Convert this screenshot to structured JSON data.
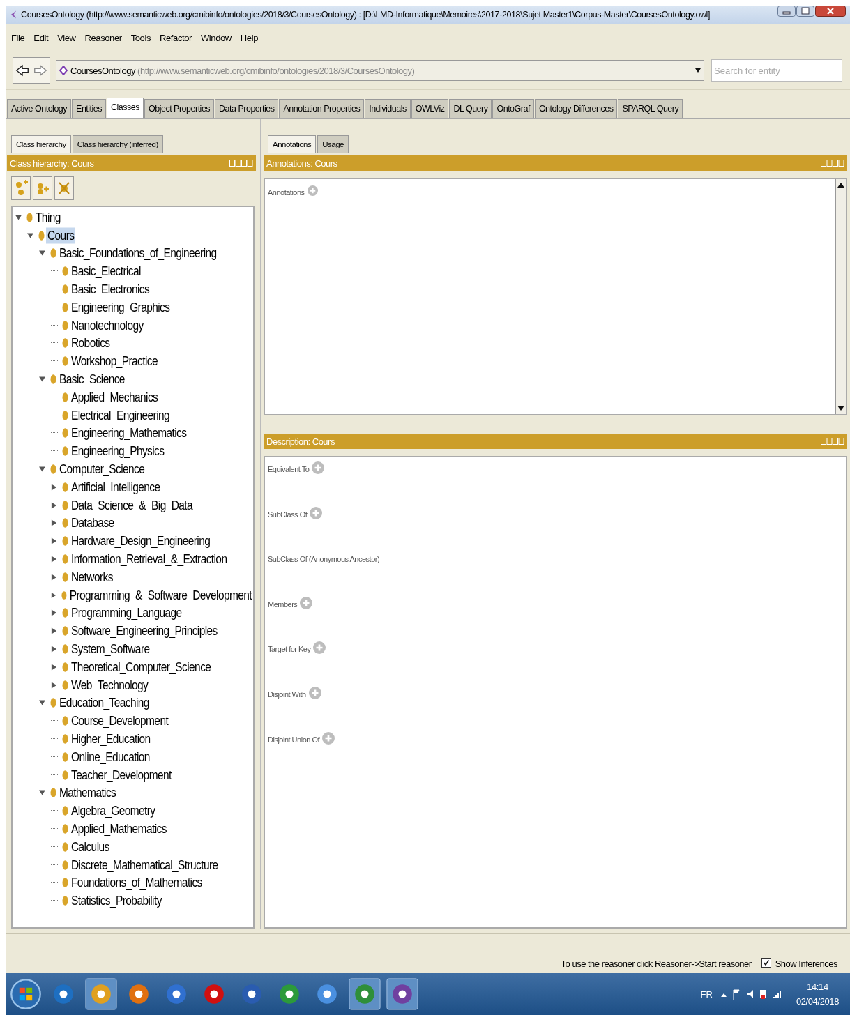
{
  "window": {
    "title": "CoursesOntology (http://www.semanticweb.org/cmibinfo/ontologies/2018/3/CoursesOntology)  : [D:\\LMD-Informatique\\Memoires\\2017-2018\\Sujet Master1\\Corpus-Master\\CoursesOntology.owl]"
  },
  "menu": [
    "File",
    "Edit",
    "View",
    "Reasoner",
    "Tools",
    "Refactor",
    "Window",
    "Help"
  ],
  "address": {
    "name": "CoursesOntology",
    "iri": "(http://www.semanticweb.org/cmibinfo/ontologies/2018/3/CoursesOntology)"
  },
  "search": {
    "placeholder": "Search for entity"
  },
  "tabs": [
    {
      "label": "Active Ontology",
      "selected": false
    },
    {
      "label": "Entities",
      "selected": false
    },
    {
      "label": "Classes",
      "selected": true
    },
    {
      "label": "Object Properties",
      "selected": false
    },
    {
      "label": "Data Properties",
      "selected": false
    },
    {
      "label": "Annotation Properties",
      "selected": false
    },
    {
      "label": "Individuals",
      "selected": false
    },
    {
      "label": "OWLViz",
      "selected": false
    },
    {
      "label": "DL Query",
      "selected": false
    },
    {
      "label": "OntoGraf",
      "selected": false
    },
    {
      "label": "Ontology Differences",
      "selected": false
    },
    {
      "label": "SPARQL Query",
      "selected": false
    }
  ],
  "left": {
    "tabs": [
      {
        "label": "Class hierarchy",
        "selected": true
      },
      {
        "label": "Class hierarchy (inferred)",
        "selected": false
      }
    ],
    "header": "Class hierarchy: Cours"
  },
  "tree": [
    {
      "label": "Thing",
      "selected": false,
      "expanded": true,
      "children": [
        {
          "label": "Cours",
          "selected": true,
          "expanded": true,
          "children": [
            {
              "label": "Basic_Foundations_of_Engineering",
              "selected": false,
              "expanded": true,
              "children": [
                {
                  "label": "Basic_Electrical",
                  "selected": false
                },
                {
                  "label": "Basic_Electronics",
                  "selected": false
                },
                {
                  "label": "Engineering_Graphics",
                  "selected": false
                },
                {
                  "label": "Nanotechnology",
                  "selected": false
                },
                {
                  "label": "Robotics",
                  "selected": false
                },
                {
                  "label": "Workshop_Practice",
                  "selected": false
                }
              ]
            },
            {
              "label": "Basic_Science",
              "selected": false,
              "expanded": true,
              "children": [
                {
                  "label": "Applied_Mechanics",
                  "selected": false
                },
                {
                  "label": "Electrical_Engineering",
                  "selected": false
                },
                {
                  "label": "Engineering_Mathematics",
                  "selected": false
                },
                {
                  "label": "Engineering_Physics",
                  "selected": false
                }
              ]
            },
            {
              "label": "Computer_Science",
              "selected": false,
              "expanded": true,
              "children": [
                {
                  "label": "Artificial_Intelligence",
                  "selected": false,
                  "expanded": false
                },
                {
                  "label": "Data_Science_&_Big_Data",
                  "selected": false,
                  "expanded": false
                },
                {
                  "label": "Database",
                  "selected": false,
                  "expanded": false
                },
                {
                  "label": "Hardware_Design_Engineering",
                  "selected": false,
                  "expanded": false
                },
                {
                  "label": "Information_Retrieval_&_Extraction",
                  "selected": false,
                  "expanded": false
                },
                {
                  "label": "Networks",
                  "selected": false,
                  "expanded": false
                },
                {
                  "label": "Programming_&_Software_Development",
                  "selected": false,
                  "expanded": false
                },
                {
                  "label": "Programming_Language",
                  "selected": false,
                  "expanded": false
                },
                {
                  "label": "Software_Engineering_Principles",
                  "selected": false,
                  "expanded": false
                },
                {
                  "label": "System_Software",
                  "selected": false,
                  "expanded": false
                },
                {
                  "label": "Theoretical_Computer_Science",
                  "selected": false,
                  "expanded": false
                },
                {
                  "label": "Web_Technology",
                  "selected": false,
                  "expanded": false
                }
              ]
            },
            {
              "label": "Education_Teaching",
              "selected": false,
              "expanded": true,
              "children": [
                {
                  "label": "Course_Development",
                  "selected": false
                },
                {
                  "label": "Higher_Education",
                  "selected": false
                },
                {
                  "label": "Online_Education",
                  "selected": false
                },
                {
                  "label": "Teacher_Development",
                  "selected": false
                }
              ]
            },
            {
              "label": "Mathematics",
              "selected": false,
              "expanded": true,
              "children": [
                {
                  "label": "Algebra_Geometry",
                  "selected": false
                },
                {
                  "label": "Applied_Mathematics",
                  "selected": false
                },
                {
                  "label": "Calculus",
                  "selected": false
                },
                {
                  "label": "Discrete_Mathematical_Structure",
                  "selected": false
                },
                {
                  "label": "Foundations_of_Mathematics",
                  "selected": false
                },
                {
                  "label": "Statistics_Probability",
                  "selected": false
                }
              ]
            }
          ]
        }
      ]
    }
  ],
  "right": {
    "tabs": [
      {
        "label": "Annotations",
        "selected": true
      },
      {
        "label": "Usage",
        "selected": false
      }
    ],
    "annotations_header": "Annotations: Cours",
    "annotations_label": "Annotations",
    "description_header": "Description: Cours",
    "sections": [
      {
        "label": "Equivalent To",
        "addable": true
      },
      {
        "label": "SubClass Of",
        "addable": true
      },
      {
        "label": "SubClass Of (Anonymous Ancestor)",
        "addable": false
      },
      {
        "label": "Members",
        "addable": true
      },
      {
        "label": "Target for Key",
        "addable": true
      },
      {
        "label": "Disjoint With",
        "addable": true
      },
      {
        "label": "Disjoint Union Of",
        "addable": true
      }
    ]
  },
  "status": {
    "message": "To use the reasoner click Reasoner->Start reasoner",
    "show_inferences": {
      "label": "Show Inferences",
      "checked": true
    }
  },
  "taskbar": {
    "language": "FR",
    "time": "14:14",
    "date": "02/04/2018"
  }
}
